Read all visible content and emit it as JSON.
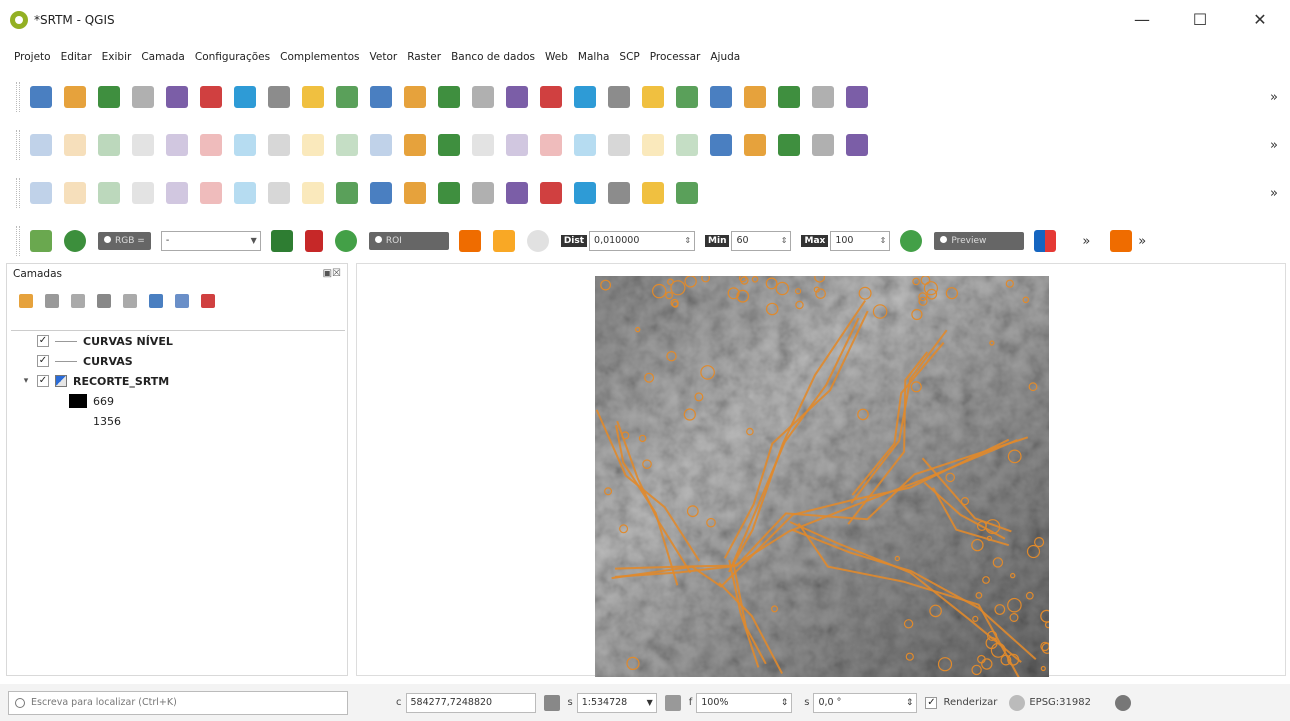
{
  "window": {
    "title": "*SRTM - QGIS",
    "controls": {
      "minimize": "—",
      "maximize": "☐",
      "close": "✕"
    }
  },
  "menu": [
    "Projeto",
    "Editar",
    "Exibir",
    "Camada",
    "Configurações",
    "Complementos",
    "Vetor",
    "Raster",
    "Banco de dados",
    "Web",
    "Malha",
    "SCP",
    "Processar",
    "Ajuda"
  ],
  "toolbars": {
    "overflow": "»",
    "row1_icons": [
      "new-project-icon",
      "open-project-icon",
      "save-project-icon",
      "save-as-icon",
      "print-layout-icon",
      "style-manager-icon",
      "pan-icon",
      "pan-to-selection-icon",
      "zoom-in-icon",
      "zoom-out-icon",
      "zoom-full-icon",
      "zoom-to-selection-icon",
      "zoom-to-layer-icon",
      "zoom-native-icon",
      "zoom-last-icon",
      "zoom-next-icon",
      "new-map-view-icon",
      "bookmark-icon",
      "refresh-icon",
      "identify-icon",
      "select-icon",
      "deselect-icon",
      "field-calc-icon",
      "attribute-table-icon",
      "statistics-icon"
    ],
    "row2_icons": [
      "current-edits-icon",
      "toggle-editing-icon",
      "save-edits-icon",
      "digitize-icon",
      "vertex-tool-icon",
      "delete-icon",
      "cut-icon",
      "copy-icon",
      "paste-icon",
      "undo-icon",
      "redo-icon",
      "label-icon",
      "diagram-icon",
      "label-pin-icon",
      "label-show-icon",
      "label-move-icon",
      "label-rotate-icon",
      "label-change-icon",
      "label-unpin-icon",
      "label-options-icon",
      "db-manager-icon",
      "grass-icon",
      "python-icon",
      "help-icon",
      "plugin-icon"
    ],
    "row3_icons": [
      "add-raster-icon",
      "add-vector-icon",
      "add-mesh-icon",
      "add-wms-icon",
      "add-spatialite-icon",
      "add-postgis-icon",
      "add-mssql-icon",
      "add-oracle-icon",
      "add-virtual-icon",
      "new-shapefile-icon",
      "new-gpkg-icon",
      "add-wcs-icon",
      "add-wfs-icon",
      "add-arcgis-icon",
      "add-csv-icon",
      "add-xyz-icon",
      "add-vector-tile-icon",
      "add-point-cloud-icon",
      "new-virtual-icon",
      "vector-dropdown-icon"
    ],
    "scp": {
      "rgb_label": "RGB =",
      "rgb_value": "-",
      "roi_label": "ROI",
      "dist_label": "Dist",
      "dist_value": "0,010000",
      "min_label": "Min",
      "min_value": "60",
      "max_label": "Max",
      "max_value": "100",
      "preview_label": "Preview"
    }
  },
  "layers_panel": {
    "title": "Camadas",
    "header_controls": "▣☒",
    "items": [
      {
        "name": "CURVAS NÍVEL",
        "checked": "✓",
        "type": "line"
      },
      {
        "name": "CURVAS",
        "checked": "✓",
        "type": "line"
      },
      {
        "name": "RECORTE_SRTM",
        "checked": "✓",
        "type": "raster",
        "expander": "▾"
      }
    ],
    "legend": {
      "min": "669",
      "max": "1356"
    }
  },
  "statusbar": {
    "search_placeholder": "Escreva para localizar (Ctrl+K)",
    "coord_label": "c",
    "coordinate": "584277,7248820",
    "scale_label": "s",
    "scale": "1:534728",
    "magnifier_label": "f",
    "magnifier": "100%",
    "rotation_label": "s",
    "rotation": "0,0 °",
    "render_check": "✓",
    "render_label": "Renderizar",
    "crs": "EPSG:31982"
  },
  "colors": {
    "contour": "#e08a2c",
    "dem_dark": "#5a5a5a",
    "dem_light": "#c8c8c8",
    "qgis_green": "#93b023"
  }
}
